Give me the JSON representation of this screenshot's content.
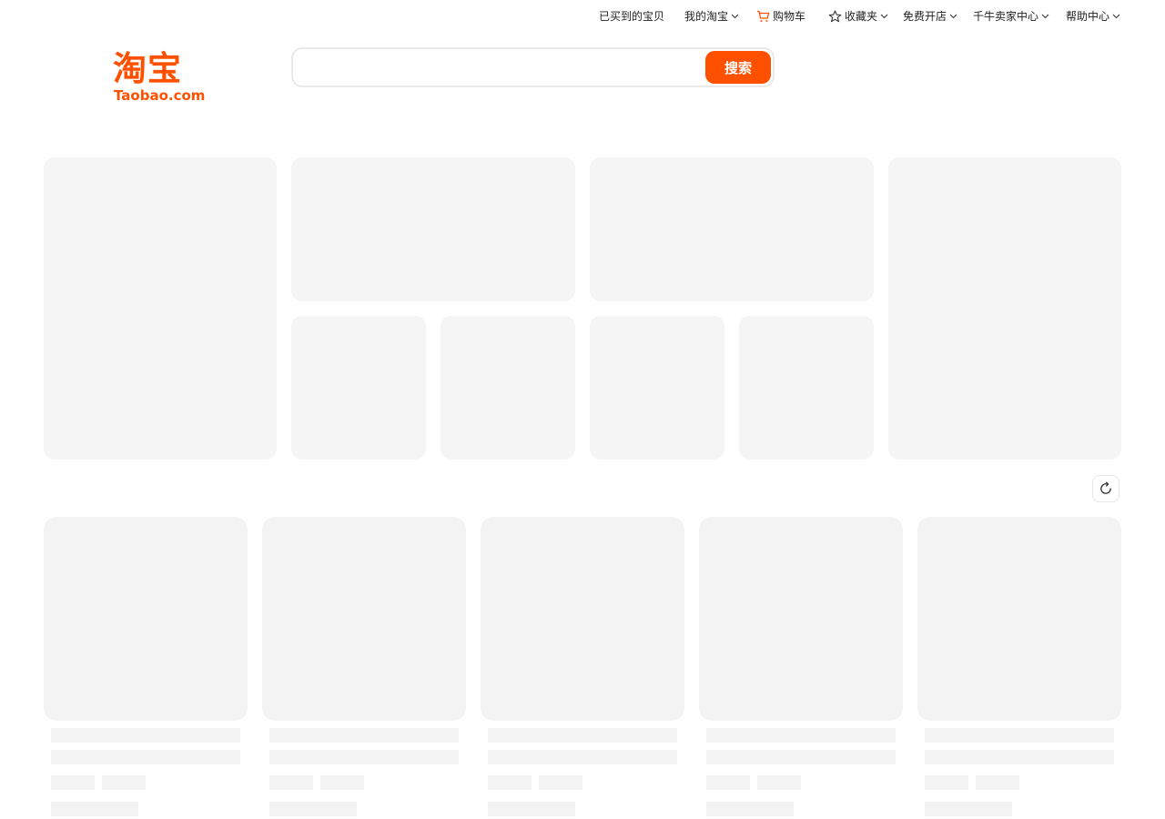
{
  "top_nav": {
    "purchased": "已买到的宝贝",
    "my_taobao": "我的淘宝",
    "cart": "购物车",
    "favorites": "收藏夹",
    "open_store": "免费开店",
    "seller_center": "千牛卖家中心",
    "help_center": "帮助中心"
  },
  "logo": {
    "cn": "淘宝",
    "en": "Taobao.com"
  },
  "search": {
    "placeholder": "",
    "value": "",
    "button_label": "搜索"
  },
  "icons": {
    "cart": "cart-icon",
    "favorites": "star-icon",
    "dropdown": "chevron-down-icon",
    "refresh": "refresh-icon"
  },
  "colors": {
    "brand": "#ff5000",
    "skeleton": "#f5f5f5",
    "text": "#1f1f1f"
  }
}
